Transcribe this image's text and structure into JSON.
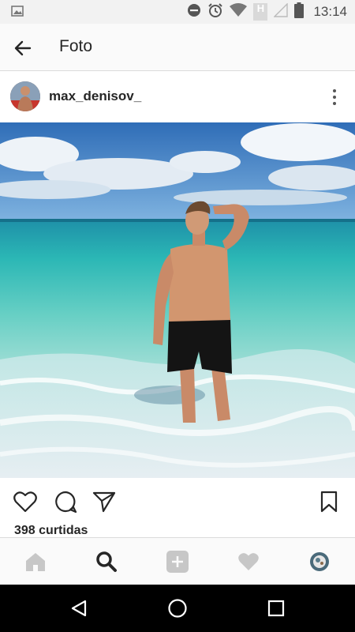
{
  "status_bar": {
    "time": "13:14",
    "icons": [
      "image-notification-icon",
      "dnd-icon",
      "alarm-icon",
      "wifi-icon",
      "h-network-icon",
      "signal-icon",
      "battery-icon"
    ],
    "network_label": "H"
  },
  "app_bar": {
    "title": "Foto",
    "back_icon": "arrow-left-icon"
  },
  "post": {
    "username": "max_denisov_",
    "more_icon": "more-vertical-icon",
    "likes_text": "398 curtidas"
  },
  "actions": {
    "icons": [
      "heart-icon",
      "comment-icon",
      "send-icon",
      "bookmark-icon"
    ]
  },
  "bottom_nav": {
    "icons": [
      "home-icon",
      "search-icon",
      "add-post-icon",
      "activity-heart-icon",
      "profile-avatar"
    ]
  },
  "system_nav": {
    "icons": [
      "back-triangle-icon",
      "home-circle-icon",
      "recents-square-icon"
    ]
  },
  "colors": {
    "sky_top": "#2f6db7",
    "sea": "#2bb7b5",
    "text": "#262626",
    "bar_bg": "#fafafa"
  }
}
